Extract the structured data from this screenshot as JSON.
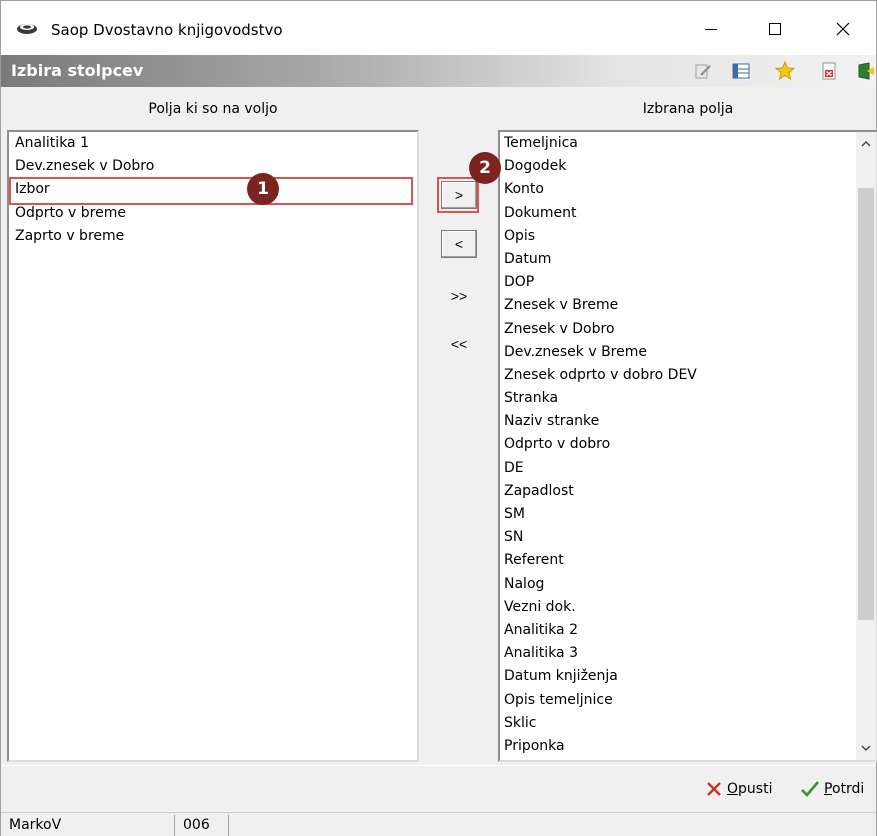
{
  "window": {
    "title": "Saop Dvostavno knjigovodstvo"
  },
  "header": {
    "title": "Izbira stolpcev"
  },
  "left_panel": {
    "heading": "Polja ki so na voljo",
    "items": [
      "Analitika 1",
      "Dev.znesek v Dobro",
      "Izbor",
      "Odprto v breme",
      "Zaprto v breme"
    ]
  },
  "right_panel": {
    "heading": "Izbrana polja",
    "items": [
      "Temeljnica",
      "Dogodek",
      "Konto",
      "Dokument",
      "Opis",
      "Datum",
      "DOP",
      "Znesek v Breme",
      "Znesek v Dobro",
      "Dev.znesek v Breme",
      "Znesek odprto v dobro DEV",
      "Stranka",
      "Naziv stranke",
      "Odprto v dobro",
      "DE",
      "Zapadlost",
      "SM",
      "SN",
      "Referent",
      "Nalog",
      "Vezni dok.",
      "Analitika 2",
      "Analitika 3",
      "Datum knjiženja",
      "Opis temeljnice",
      "Sklic",
      "Priponka"
    ]
  },
  "transfer_buttons": {
    "add": ">",
    "remove": "<",
    "add_all": ">>",
    "remove_all": "<<"
  },
  "annotations": {
    "badge_1": "1",
    "badge_2": "2"
  },
  "footer": {
    "cancel": {
      "first": "O",
      "rest": "pusti"
    },
    "confirm": {
      "first": "P",
      "rest": "otrdi"
    }
  },
  "status": {
    "user": "MarkoV",
    "code": "006"
  },
  "colors": {
    "highlight": "#d9534f",
    "badge": "#7b2420",
    "cancel_icon": "#c0392b",
    "confirm_icon": "#2e9a2e"
  }
}
